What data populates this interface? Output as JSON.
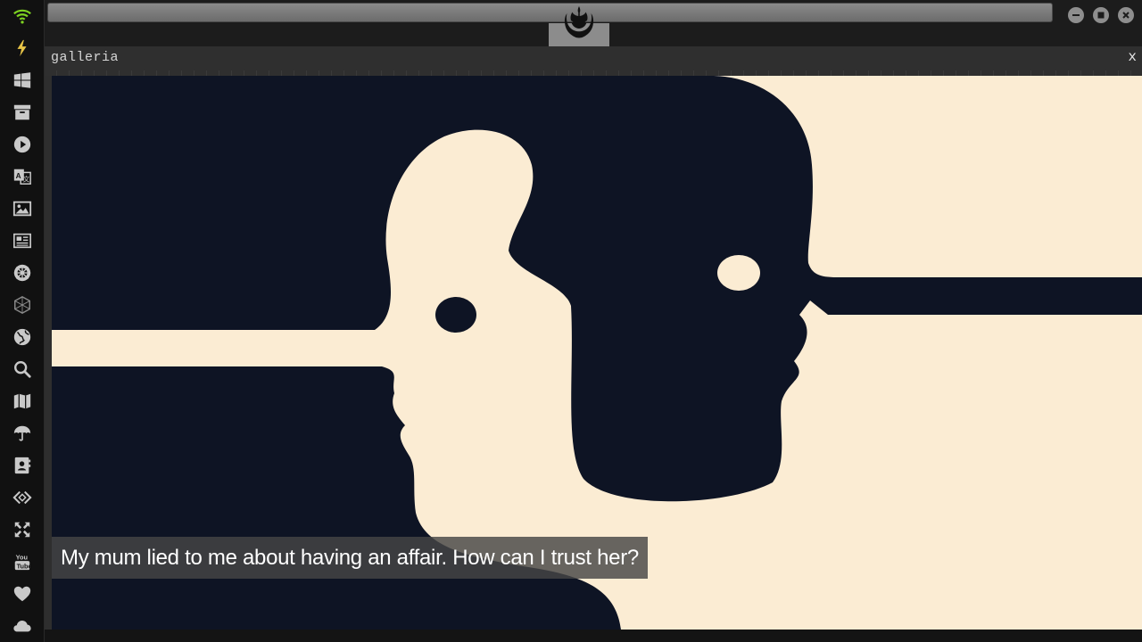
{
  "sidebar": {
    "icons": [
      {
        "name": "wifi-icon"
      },
      {
        "name": "lightning-icon"
      },
      {
        "name": "windows-icon"
      },
      {
        "name": "archive-icon"
      },
      {
        "name": "play-icon"
      },
      {
        "name": "translate-icon"
      },
      {
        "name": "image-icon"
      },
      {
        "name": "newspaper-icon"
      },
      {
        "name": "empire-icon"
      },
      {
        "name": "hexagon-icon"
      },
      {
        "name": "globe-icon"
      },
      {
        "name": "search-icon"
      },
      {
        "name": "map-icon"
      },
      {
        "name": "umbrella-icon"
      },
      {
        "name": "contacts-icon"
      },
      {
        "name": "code-icon"
      },
      {
        "name": "expand-icon"
      },
      {
        "name": "youtube-icon"
      },
      {
        "name": "heart-icon"
      },
      {
        "name": "cloud-icon"
      }
    ],
    "accent_color": "#e8c547",
    "wifi_color": "#7ed321"
  },
  "topbar": {
    "emblem": "rebel-alliance-icon"
  },
  "window": {
    "title": "galleria",
    "close_label": "x"
  },
  "gallery": {
    "caption": "My mum lied to me about having an affair. How can I trust her?",
    "colors": {
      "navy": "#0e1424",
      "cream": "#fbecd3"
    }
  }
}
